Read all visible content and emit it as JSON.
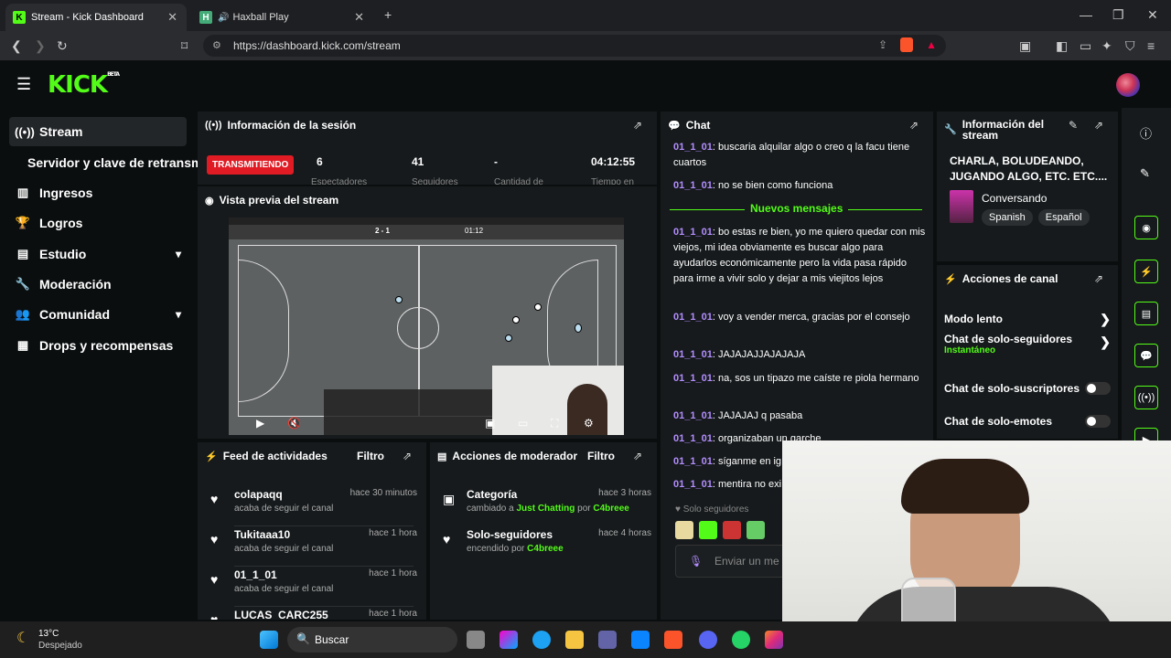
{
  "browser": {
    "tabs": [
      {
        "label": "Stream - Kick Dashboard",
        "favicon": "K",
        "active": true
      },
      {
        "label": "Haxball Play",
        "favicon": "H",
        "active": false
      }
    ],
    "url": "https://dashboard.kick.com/stream"
  },
  "app": {
    "logo": "KICK",
    "logo_badge": "BETA",
    "sidebar": [
      {
        "label": "Stream",
        "icon": "broadcast-icon",
        "active": true
      },
      {
        "label": "Servidor y clave de retransm",
        "icon": "",
        "active": false
      },
      {
        "label": "Ingresos",
        "icon": "chart-icon",
        "active": false
      },
      {
        "label": "Logros",
        "icon": "trophy-icon",
        "active": false
      },
      {
        "label": "Estudio",
        "icon": "studio-icon",
        "active": false,
        "chevron": true
      },
      {
        "label": "Moderación",
        "icon": "wrench-icon",
        "active": false
      },
      {
        "label": "Comunidad",
        "icon": "people-icon",
        "active": false,
        "chevron": true
      },
      {
        "label": "Drops y recompensas",
        "icon": "gift-icon",
        "active": false
      }
    ],
    "session": {
      "title": "Información de la sesión",
      "status": "TRANSMITIENDO",
      "stats": [
        {
          "value": "6",
          "label": "Espectadores"
        },
        {
          "value": "41",
          "label": "Seguidores"
        },
        {
          "value": "-",
          "label": "Cantidad de"
        },
        {
          "value": "04:12:55",
          "label": "Tiempo en"
        }
      ]
    },
    "preview": {
      "title": "Vista previa del stream",
      "score": "2 - 1",
      "time": "01:12"
    },
    "chat": {
      "title": "Chat",
      "new_messages": "Nuevos mensajes",
      "messages": [
        {
          "user": "01_1_01",
          "text": "buscaria alquilar algo o creo q la facu tiene cuartos"
        },
        {
          "user": "01_1_01",
          "text": "no se bien como funciona"
        },
        {
          "user": "01_1_01",
          "text": "bo estas re bien, yo me quiero quedar con mis viejos, mi idea obviamente es buscar algo para ayudarlos económicamente pero la vida pasa rápido para irme a vivir solo y dejar a mis viejitos lejos"
        },
        {
          "user": "01_1_01",
          "text": "voy a vender merca, gracias por el consejo"
        },
        {
          "user": "01_1_01",
          "text": "JAJAJAJJAJAJAJA"
        },
        {
          "user": "01_1_01",
          "text": "na, sos un tipazo me caíste re piola hermano"
        },
        {
          "user": "01_1_01",
          "text": "JAJAJAJ q pasaba"
        },
        {
          "user": "01_1_01",
          "text": "organizaban un garche"
        },
        {
          "user": "01_1_01",
          "text": "síganme en ig"
        },
        {
          "user": "01_1_01",
          "text": "mentira no exi"
        }
      ],
      "followers_only": "Solo seguidores",
      "input_placeholder": "Enviar un me"
    },
    "stream_info": {
      "title": "Información del stream",
      "stream_title": "CHARLA, BOLUDEANDO, JUGANDO ALGO, ETC. ETC....",
      "category": "Conversando",
      "tags": [
        "Spanish",
        "Español"
      ]
    },
    "channel_actions": {
      "title": "Acciones de canal",
      "items": [
        {
          "label": "Modo lento",
          "control": "chevron"
        },
        {
          "label": "Chat de solo-seguidores",
          "sub": "Instantáneo",
          "control": "chevron"
        },
        {
          "label": "Chat de solo-suscriptores",
          "control": "toggle"
        },
        {
          "label": "Chat de solo-emotes",
          "control": "toggle"
        }
      ]
    },
    "activity_feed": {
      "title": "Feed de actividades",
      "filter": "Filtro",
      "items": [
        {
          "user": "colapaqq",
          "action": "acaba de seguir el canal",
          "time": "hace 30 minutos"
        },
        {
          "user": "Tukitaaa10",
          "action": "acaba de seguir el canal",
          "time": "hace 1 hora"
        },
        {
          "user": "01_1_01",
          "action": "acaba de seguir el canal",
          "time": "hace 1 hora"
        },
        {
          "user": "LUCAS_CARC255",
          "action": "",
          "time": "hace 1 hora"
        }
      ]
    },
    "mod_actions": {
      "title": "Acciones de moderador",
      "filter": "Filtro",
      "items": [
        {
          "title": "Categoría",
          "pre": "cambiado a",
          "value": "Just Chatting",
          "by": "por",
          "mod": "C4breee",
          "time": "hace 3 horas"
        },
        {
          "title": "Solo-seguidores",
          "pre": "encendido",
          "value": "",
          "by": "por",
          "mod": "C4breee",
          "time": "hace 4 horas"
        }
      ]
    }
  },
  "taskbar": {
    "weather_temp": "13°C",
    "weather_desc": "Despejado",
    "search_label": "Buscar"
  },
  "colors": {
    "accent": "#53fc18",
    "live": "#e01b24",
    "username": "#b38dff"
  }
}
